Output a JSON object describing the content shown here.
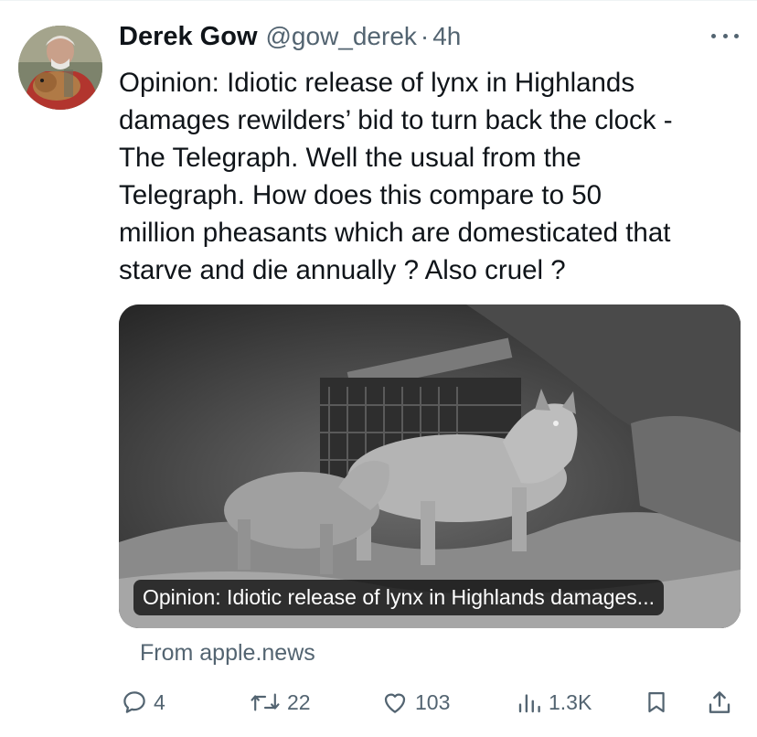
{
  "tweet": {
    "author_name": "Derek Gow",
    "handle": "@gow_derek",
    "separator": "·",
    "time": "4h",
    "text": "Opinion: Idiotic release of lynx in Highlands\ndamages rewilders’ bid to turn back the clock -\nThe Telegraph. Well the usual from the\nTelegraph. How does this compare to 50\nmillion pheasants which are domesticated that\nstarve and die annually ? Also cruel ?",
    "more_icon": "more-horizontal-icon"
  },
  "card": {
    "caption": "Opinion: Idiotic release of lynx in Highlands damages...",
    "source": "From apple.news"
  },
  "actions": {
    "replies": "4",
    "retweets": "22",
    "likes": "103",
    "views": "1.3K",
    "icons": [
      "reply-icon",
      "retweet-icon",
      "like-icon",
      "views-icon",
      "bookmark-icon",
      "share-icon"
    ]
  },
  "colors": {
    "text": "#0f1419",
    "secondary": "#536471",
    "background": "#ffffff"
  }
}
